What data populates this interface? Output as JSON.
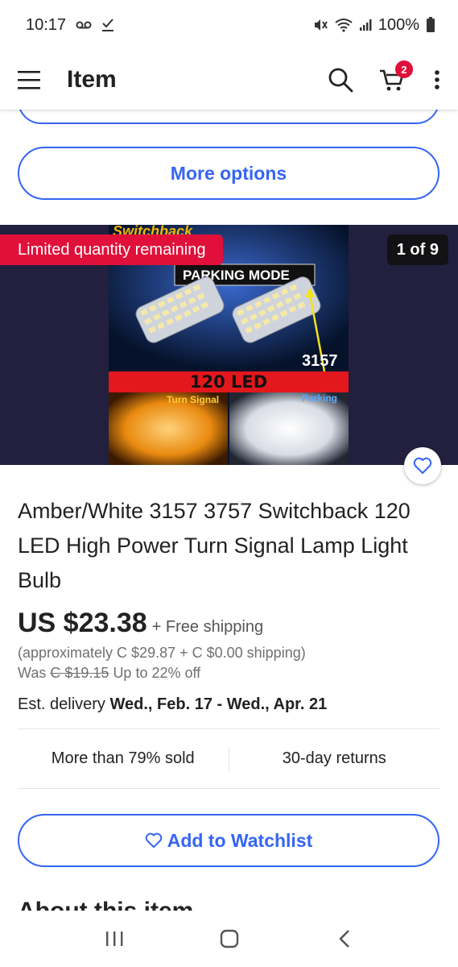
{
  "status_bar": {
    "time": "10:17",
    "battery": "100%"
  },
  "header": {
    "title": "Item",
    "cart_count": "2"
  },
  "buttons": {
    "more_options": "More options",
    "add_to_watchlist": "Add to Watchlist"
  },
  "gallery": {
    "limited_badge": "Limited quantity remaining",
    "counter": "1 of 9",
    "image_texts": {
      "brand": "Switchback",
      "mode": "PARKING MODE",
      "model": "3157",
      "led": "120 LED",
      "turn_signal": "Turn Signal",
      "parking": "Parking"
    }
  },
  "item": {
    "title": "Amber/White 3157 3757 Switchback 120 LED High Power Turn Signal Lamp Light Bulb",
    "price": "US $23.38",
    "shipping": "+ Free shipping",
    "approx": "(approximately C $29.87 + C $0.00 shipping)",
    "was_label": "Was",
    "was_price": "C $19.15",
    "discount": "Up to 22% off",
    "delivery_label": "Est. delivery",
    "delivery_dates": "Wed., Feb. 17 - Wed., Apr. 21"
  },
  "stats": {
    "sold": "More than 79% sold",
    "returns": "30-day returns"
  },
  "sections": {
    "about": "About this item"
  },
  "colors": {
    "accent": "#3665f3",
    "badge_red": "#e0103a"
  }
}
